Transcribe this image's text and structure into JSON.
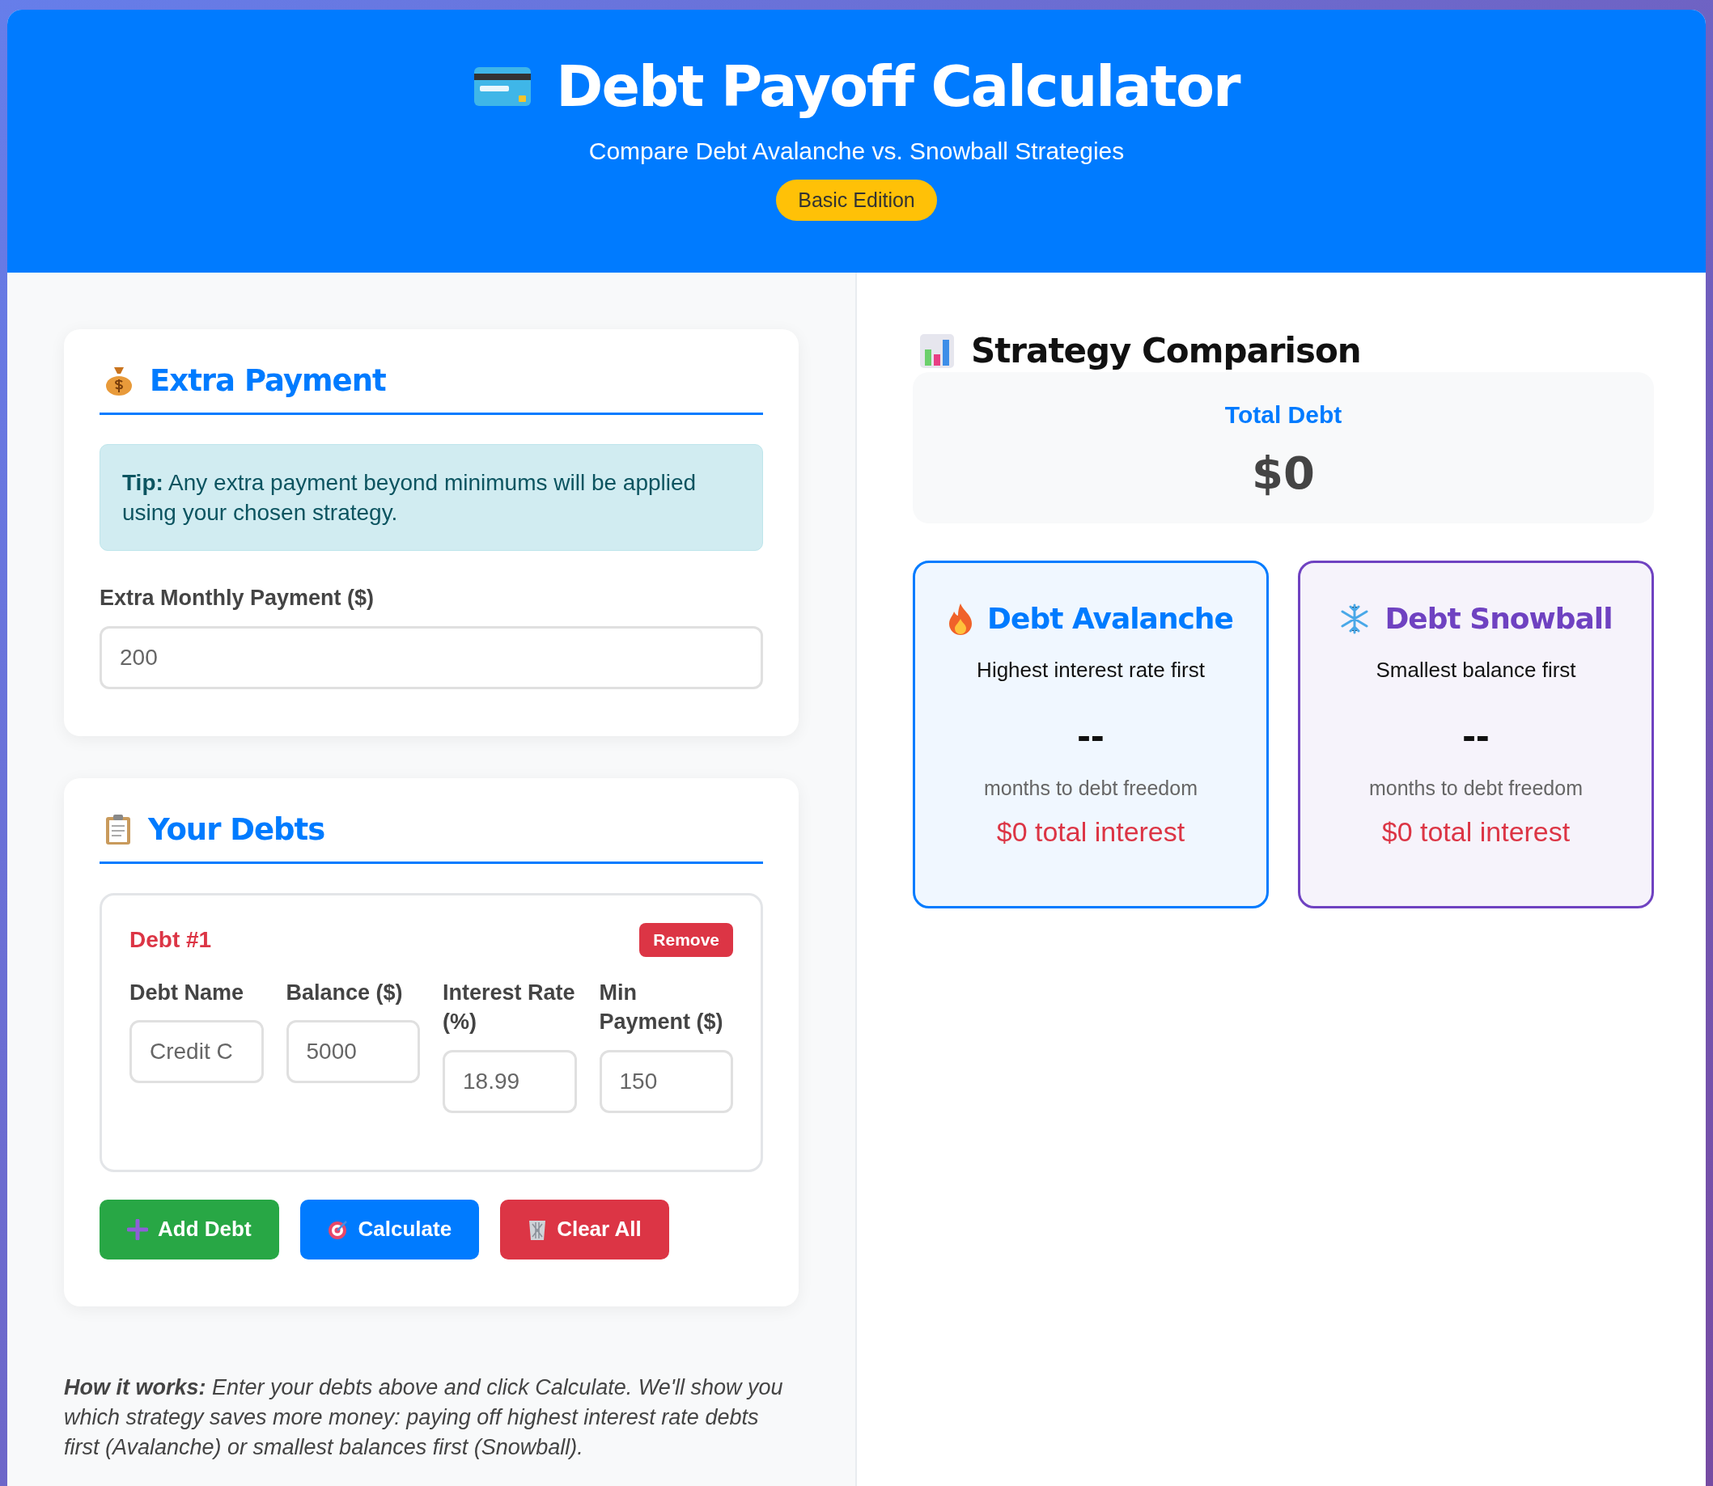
{
  "header": {
    "title": "Debt Payoff Calculator",
    "subtitle": "Compare Debt Avalanche vs. Snowball Strategies",
    "badge": "Basic Edition"
  },
  "extra_payment": {
    "title": "Extra Payment",
    "tip": "**Tip:** Any extra payment beyond minimums will be applied using your chosen strategy.",
    "field": {
      "label": "Extra Monthly Payment ($)",
      "placeholder": "200"
    }
  },
  "debts": {
    "title": "Your Debts",
    "items": [
      {
        "heading": "Debt #1",
        "remove": "Remove",
        "fields": [
          {
            "label": "Debt Name",
            "placeholder": "Credit C"
          },
          {
            "label": "Balance ($)",
            "placeholder": "5000"
          },
          {
            "label": "Interest Rate (%)",
            "placeholder": "18.99"
          },
          {
            "label": "Min Payment ($)",
            "placeholder": "150"
          }
        ]
      }
    ],
    "buttons": [
      {
        "kind": "add",
        "label": "Add Debt"
      },
      {
        "kind": "calculate",
        "label": "Calculate"
      },
      {
        "kind": "clear",
        "label": "Clear All"
      }
    ]
  },
  "note": "**How it works:** Enter your debts above and click Calculate. We'll show you which strategy saves more money: paying off highest interest rate debts first (Avalanche) or smallest balances first (Snowball).",
  "comparison": {
    "title": "Strategy Comparison",
    "total": {
      "label": "Total Debt",
      "value": "$0"
    },
    "strategies": [
      {
        "kind": "avalanche",
        "title": "Debt Avalanche",
        "description": "Highest interest rate first",
        "months": "--",
        "months_label": "months to debt freedom",
        "interest": "$0 total interest"
      },
      {
        "kind": "snowball",
        "title": "Debt Snowball",
        "description": "Smallest balance first",
        "months": "--",
        "months_label": "months to debt freedom",
        "interest": "$0 total interest"
      }
    ]
  }
}
